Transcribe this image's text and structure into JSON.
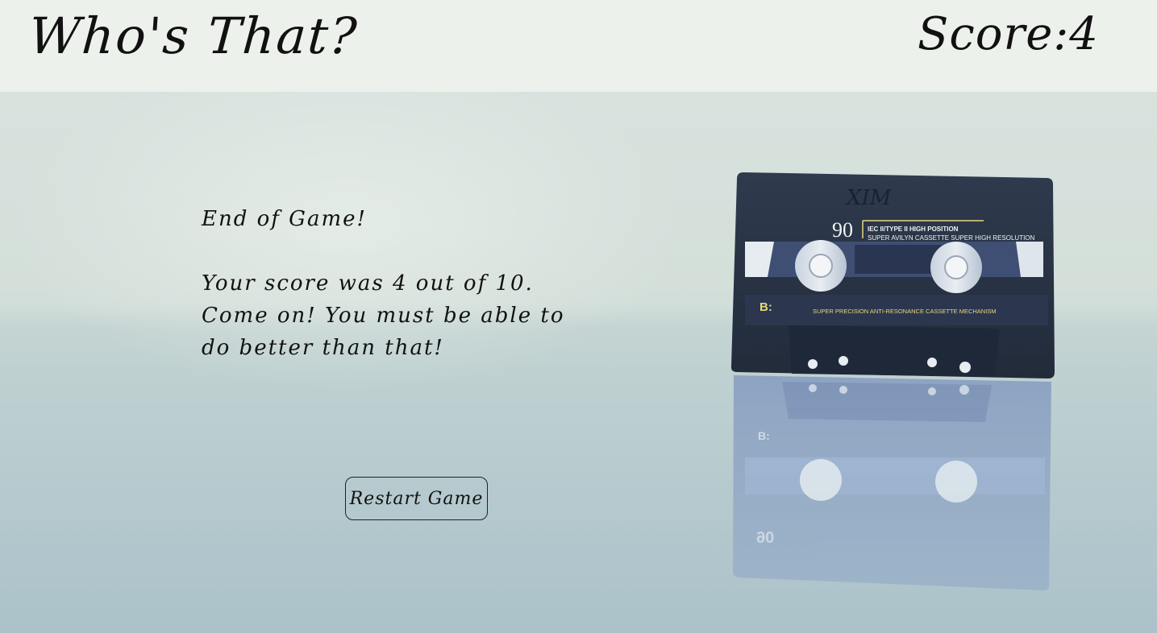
{
  "header": {
    "title": "Who's That?",
    "score_label": "Score:",
    "score_value": "4"
  },
  "result": {
    "heading": "End of Game!",
    "message": "Your score was 4 out of 10. Come on! You must be able to do better than that!"
  },
  "restart_button": {
    "label": "Restart Game"
  },
  "cassette": {
    "handwriting": "XIM",
    "number": "90",
    "type_line": "IEC II/TYPE II HIGH POSITION",
    "brand_line": "SUPER AVILYN CASSETTE SUPER HIGH RESOLUTION",
    "side": "B:",
    "mechanism": "SUPER PRECISION ANTI-RESONANCE CASSETTE MECHANISM"
  },
  "colors": {
    "background": "#d4dfda",
    "header": "#f2f5f0",
    "cassette": "#2b3547",
    "cassette_label": "#e8d87a"
  }
}
